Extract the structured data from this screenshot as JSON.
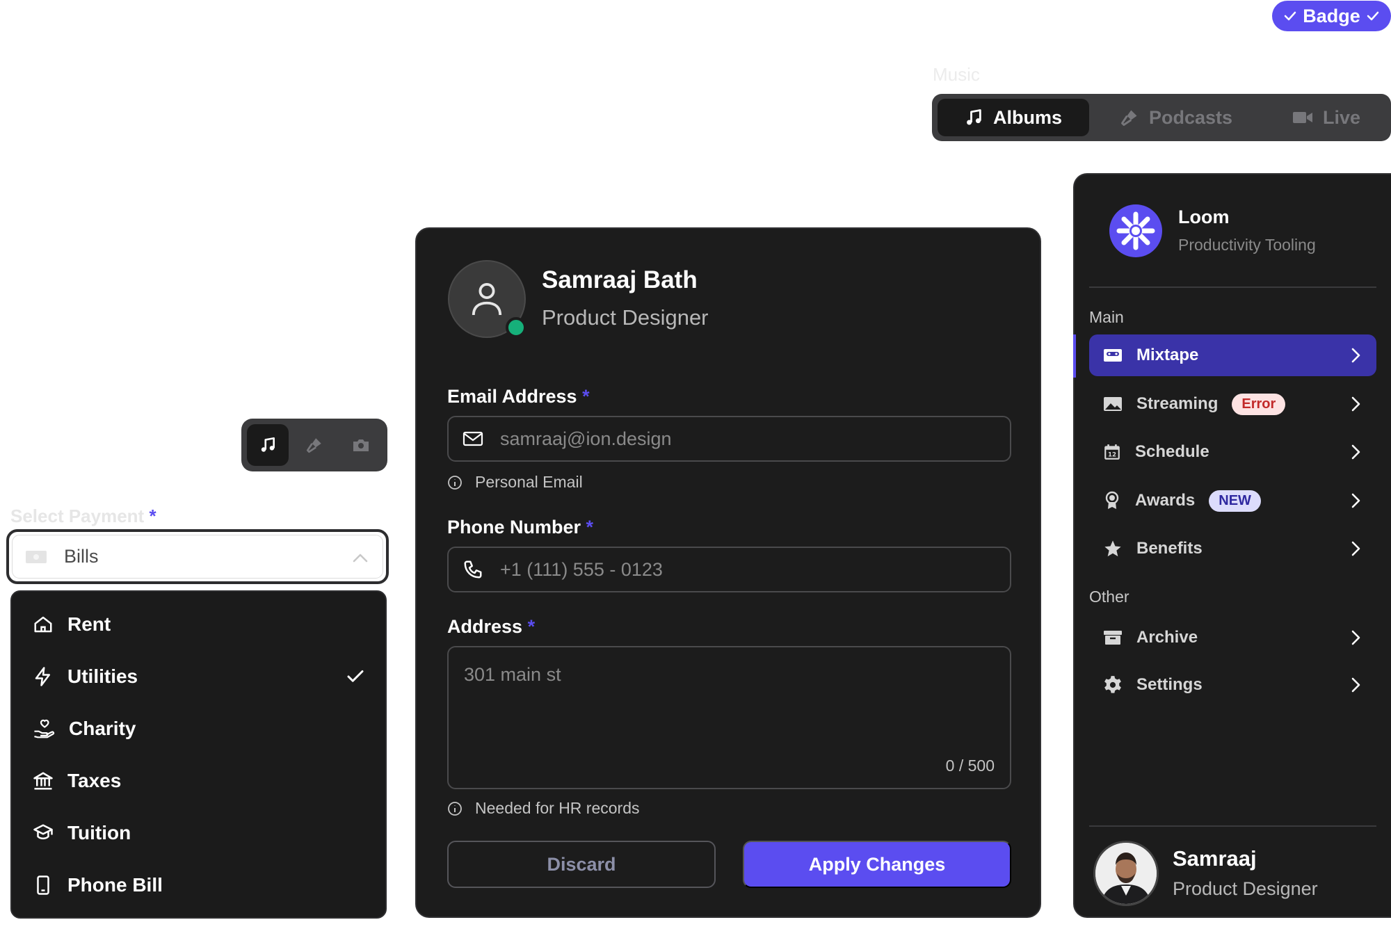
{
  "badge": {
    "label": "Badge"
  },
  "music": {
    "label": "Music",
    "tabs": [
      {
        "label": "Albums",
        "icon": "music-note-icon",
        "active": true
      },
      {
        "label": "Podcasts",
        "icon": "microphone-icon",
        "active": false
      },
      {
        "label": "Live",
        "icon": "video-icon",
        "active": false
      }
    ]
  },
  "icon_toggle": {
    "items": [
      {
        "icon": "music-note-icon",
        "active": true
      },
      {
        "icon": "microphone-icon",
        "active": false
      },
      {
        "icon": "camera-icon",
        "active": false
      }
    ]
  },
  "payment": {
    "label": "Select Payment",
    "required_mark": "*",
    "selected": "Bills",
    "options": [
      {
        "label": "Rent",
        "icon": "home-icon"
      },
      {
        "label": "Utilities",
        "icon": "bolt-icon",
        "checked": true
      },
      {
        "label": "Charity",
        "icon": "hand-heart-icon"
      },
      {
        "label": "Taxes",
        "icon": "bank-icon"
      },
      {
        "label": "Tuition",
        "icon": "graduation-cap-icon"
      },
      {
        "label": "Phone Bill",
        "icon": "phone-device-icon"
      }
    ]
  },
  "profile": {
    "name": "Samraaj Bath",
    "role": "Product Designer",
    "email": {
      "label": "Email Address",
      "required_mark": "*",
      "placeholder": "samraaj@ion.design",
      "hint": "Personal Email"
    },
    "phone": {
      "label": "Phone Number",
      "required_mark": "*",
      "placeholder": "+1 (111) 555 - 0123"
    },
    "address": {
      "label": "Address",
      "required_mark": "*",
      "placeholder": "301 main st",
      "counter": "0 / 500",
      "hint": "Needed for HR records"
    },
    "discard_label": "Discard",
    "apply_label": "Apply Changes"
  },
  "sidebar": {
    "app_name": "Loom",
    "app_sub": "Productivity Tooling",
    "main_label": "Main",
    "main_items": [
      {
        "label": "Mixtape",
        "icon": "cassette-icon",
        "active": true
      },
      {
        "label": "Streaming",
        "icon": "image-icon",
        "tag": "Error"
      },
      {
        "label": "Schedule",
        "icon": "calendar-icon"
      },
      {
        "label": "Awards",
        "icon": "award-icon",
        "tag": "NEW"
      },
      {
        "label": "Benefits",
        "icon": "star-icon"
      }
    ],
    "other_label": "Other",
    "other_items": [
      {
        "label": "Archive",
        "icon": "archive-icon"
      },
      {
        "label": "Settings",
        "icon": "gear-icon"
      }
    ],
    "user": {
      "name": "Samraaj",
      "role": "Product Designer"
    }
  },
  "colors": {
    "accent": "#5b4df0",
    "panel": "#1c1c1c",
    "online": "#16b07a",
    "error_bg": "#fde3e3",
    "error_text": "#c22a2a"
  }
}
